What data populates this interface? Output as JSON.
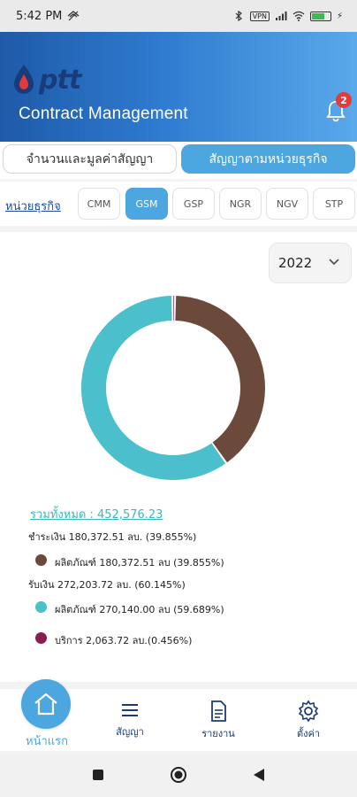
{
  "status_bar": {
    "time": "5:42 PM",
    "vpn": "VPN",
    "battery": "85"
  },
  "header": {
    "logo_text": "ptt",
    "title": "Contract Management",
    "notification_count": "2"
  },
  "tabs": [
    {
      "label": "จำนวนและมูลค่าสัญญา",
      "active": false
    },
    {
      "label": "สัญญาตามหน่วยธุรกิจ",
      "active": true
    }
  ],
  "business_unit": {
    "label": "หน่วยธุรกิจ",
    "units": [
      "CMM",
      "GSM",
      "GSP",
      "NGR",
      "NGV",
      "STP"
    ],
    "selected": "GSM"
  },
  "year_select": {
    "value": "2022"
  },
  "chart_data": {
    "type": "pie",
    "variant": "donut",
    "total": 452576.23,
    "slices": [
      {
        "label": "ผลิตภัณฑ์ (ชำระเงิน)",
        "value": 180372.51,
        "percent": 39.855,
        "color": "#6b4a3c"
      },
      {
        "label": "ผลิตภัณฑ์ (รับเงิน)",
        "value": 270140.0,
        "percent": 59.689,
        "color": "#4bbfcb"
      },
      {
        "label": "บริการ",
        "value": 2063.72,
        "percent": 0.456,
        "color": "#8a1e4e"
      }
    ]
  },
  "summary": {
    "total_text": "รวมทั้งหมด : 452,576.23",
    "pay_text": "ชำระเงิน 180,372.51 ลบ. (39.855%)",
    "pay_items": [
      {
        "text": "ผลิตภัณฑ์ 180,372.51 ลบ (39.855%)",
        "color": "#6b4a3c"
      }
    ],
    "receive_text": "รับเงิน 272,203.72 ลบ. (60.145%)",
    "receive_items": [
      {
        "text": "ผลิตภัณฑ์ 270,140.00 ลบ (59.689%)",
        "color": "#4bbfcb"
      },
      {
        "text": "บริการ 2,063.72 ลบ.(0.456%)",
        "color": "#8a1e4e"
      }
    ]
  },
  "nav": [
    {
      "label": "หน้าแรก",
      "icon": "home-icon"
    },
    {
      "label": "สัญญา",
      "icon": "list-icon"
    },
    {
      "label": "รายงาน",
      "icon": "document-icon"
    },
    {
      "label": "ตั้งค่า",
      "icon": "gear-icon"
    }
  ]
}
